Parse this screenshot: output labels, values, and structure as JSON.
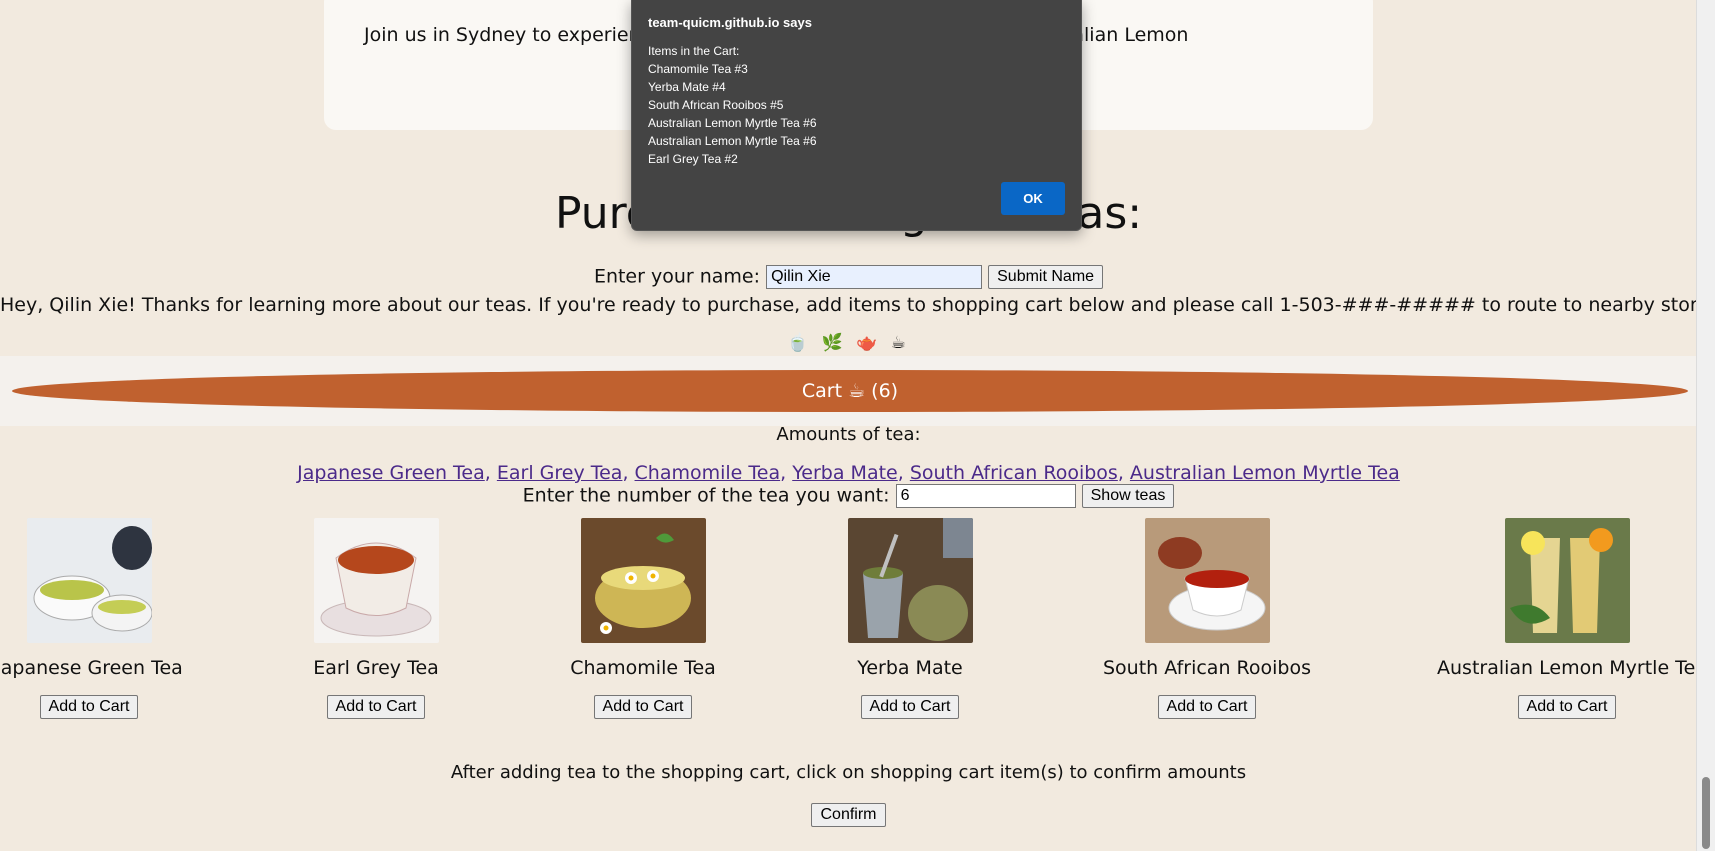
{
  "top_card": {
    "text": "Join us in Sydney to experience the taste and aroma of our premium Australian Lemon"
  },
  "heading": "Purchase our organic teas:",
  "name_form": {
    "label": "Enter your name:",
    "value": "Qilin Xie",
    "submit_label": "Submit Name"
  },
  "greeting": "Hey, Qilin Xie! Thanks for learning more about our teas. If you're ready to purchase, add items to shopping cart below and please call 1-503-###-##### to route to nearby store.",
  "icons": [
    "🍵",
    "🌿",
    "🫖",
    "☕"
  ],
  "cart": {
    "label": "Cart ☕ (6)"
  },
  "amounts_label": "Amounts of tea:",
  "tea_links": [
    "Japanese Green Tea",
    "Earl Grey Tea",
    "Chamomile Tea",
    "Yerba Mate",
    "South African Rooibos",
    "Australian Lemon Myrtle Tea"
  ],
  "count_form": {
    "label": "Enter the number of the tea you want:",
    "value": "6",
    "button_label": "Show teas"
  },
  "teas": [
    {
      "name": "Japanese Green Tea",
      "button": "Add to Cart"
    },
    {
      "name": "Earl Grey Tea",
      "button": "Add to Cart"
    },
    {
      "name": "Chamomile Tea",
      "button": "Add to Cart"
    },
    {
      "name": "Yerba Mate",
      "button": "Add to Cart"
    },
    {
      "name": "South African Rooibos",
      "button": "Add to Cart"
    },
    {
      "name": "Australian Lemon Myrtle Tea",
      "button": "Add to Cart"
    }
  ],
  "after_text": "After adding tea to the shopping cart, click on shopping cart item(s) to confirm amounts",
  "confirm_label": "Confirm",
  "dialog": {
    "title": "team-quicm.github.io says",
    "lines": [
      "Items in the Cart:",
      "Chamomile Tea #3",
      "Yerba Mate #4",
      "South African Rooibos #5",
      "Australian Lemon Myrtle Tea #6",
      "Australian Lemon Myrtle Tea #6",
      "Earl Grey Tea #2"
    ],
    "ok_label": "OK"
  },
  "colors": {
    "page_bg": "#f2eadf",
    "cart": "#c0612f",
    "link": "#4b2a8a",
    "dialog_bg": "#444444",
    "ok_button": "#0a67c6"
  }
}
